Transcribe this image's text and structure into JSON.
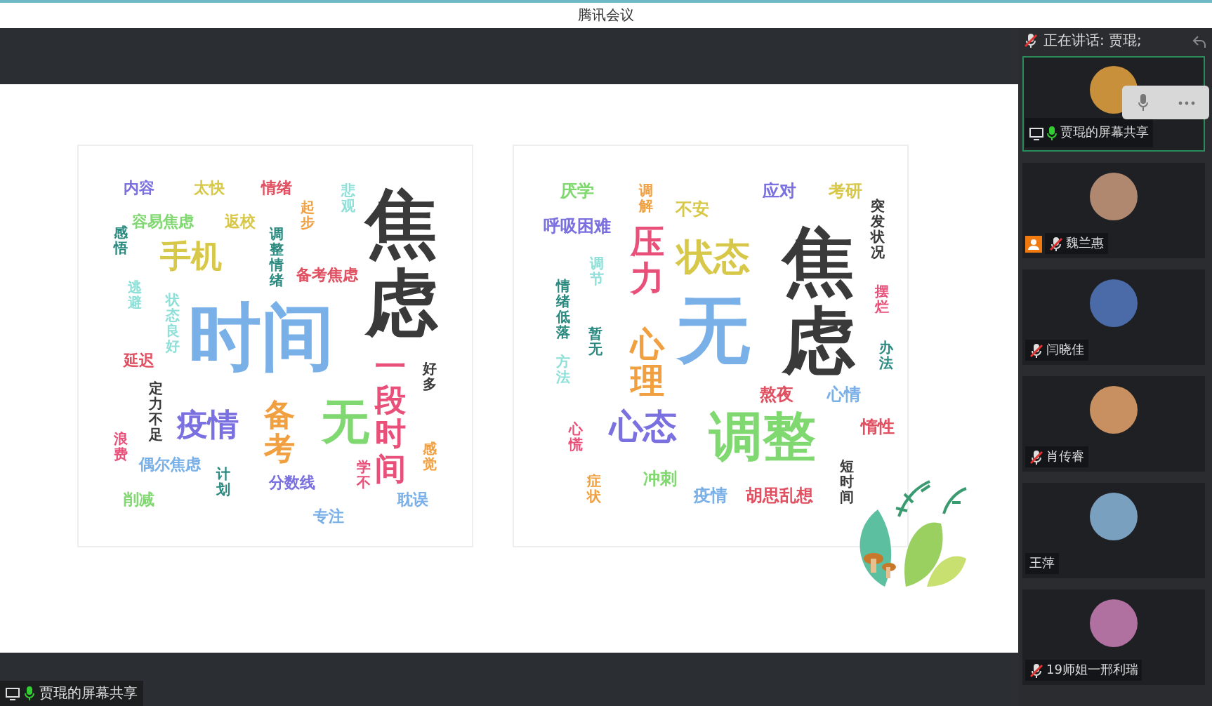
{
  "window": {
    "title": "腾讯会议"
  },
  "clouds": [
    {
      "words": [
        {
          "text": "内容",
          "color": "#7a70e0",
          "vertical": false
        },
        {
          "text": "太快",
          "color": "#d8c84a",
          "vertical": false
        },
        {
          "text": "情绪",
          "color": "#e05060",
          "vertical": false
        },
        {
          "text": "感悟",
          "color": "#2a8a80",
          "vertical": true
        },
        {
          "text": "容易焦虑",
          "color": "#80d870",
          "vertical": false
        },
        {
          "text": "返校",
          "color": "#d8c84a",
          "vertical": false
        },
        {
          "text": "起步",
          "color": "#f0a040",
          "vertical": true
        },
        {
          "text": "悲观",
          "color": "#8fe0d8",
          "vertical": true
        },
        {
          "text": "手机",
          "color": "#d8c84a",
          "vertical": false
        },
        {
          "text": "逃避",
          "color": "#8fe0d8",
          "vertical": true
        },
        {
          "text": "调整情绪",
          "color": "#2a8a80",
          "vertical": true
        },
        {
          "text": "备考焦虑",
          "color": "#e05060",
          "vertical": false
        },
        {
          "text": "延迟",
          "color": "#e05060",
          "vertical": false
        },
        {
          "text": "状态良好",
          "color": "#8fe0d8",
          "vertical": true
        },
        {
          "text": "时间",
          "color": "#7ab0e8",
          "vertical": false
        },
        {
          "text": "焦虑",
          "color": "#3a3a3a",
          "vertical": true
        },
        {
          "text": "浪费",
          "color": "#e8507a",
          "vertical": true
        },
        {
          "text": "定力不足",
          "color": "#3a3a3a",
          "vertical": true
        },
        {
          "text": "疫情",
          "color": "#7a70e0",
          "vertical": false
        },
        {
          "text": "偶尔焦虑",
          "color": "#7ab0e8",
          "vertical": false
        },
        {
          "text": "削减",
          "color": "#80d870",
          "vertical": false
        },
        {
          "text": "计划",
          "color": "#2a8a80",
          "vertical": true
        },
        {
          "text": "备考",
          "color": "#f0a040",
          "vertical": true
        },
        {
          "text": "无",
          "color": "#80d870",
          "vertical": false
        },
        {
          "text": "分数线",
          "color": "#7a70e0",
          "vertical": false
        },
        {
          "text": "学不",
          "color": "#e8507a",
          "vertical": true
        },
        {
          "text": "一段时间",
          "color": "#e8507a",
          "vertical": true
        },
        {
          "text": "好多",
          "color": "#3a3a3a",
          "vertical": true
        },
        {
          "text": "感觉",
          "color": "#f0a040",
          "vertical": true
        },
        {
          "text": "专注",
          "color": "#7ab0e8",
          "vertical": false
        },
        {
          "text": "耽误",
          "color": "#7ab0e8",
          "vertical": false
        }
      ]
    },
    {
      "words": [
        {
          "text": "厌学",
          "color": "#80d870",
          "vertical": false
        },
        {
          "text": "调解",
          "color": "#f0a040",
          "vertical": true
        },
        {
          "text": "不安",
          "color": "#d8c84a",
          "vertical": false
        },
        {
          "text": "应对",
          "color": "#7a70e0",
          "vertical": false
        },
        {
          "text": "考研",
          "color": "#d8c84a",
          "vertical": false
        },
        {
          "text": "呼吸困难",
          "color": "#7a70e0",
          "vertical": false
        },
        {
          "text": "情绪低落",
          "color": "#2a8a80",
          "vertical": true
        },
        {
          "text": "调节",
          "color": "#8fe0d8",
          "vertical": true
        },
        {
          "text": "压力",
          "color": "#e8507a",
          "vertical": true
        },
        {
          "text": "状态",
          "color": "#d8c84a",
          "vertical": false
        },
        {
          "text": "方法",
          "color": "#8fe0d8",
          "vertical": true
        },
        {
          "text": "暂无",
          "color": "#2a8a80",
          "vertical": true
        },
        {
          "text": "心理",
          "color": "#f0a040",
          "vertical": true
        },
        {
          "text": "无",
          "color": "#7ab0e8",
          "vertical": false
        },
        {
          "text": "焦虑",
          "color": "#3a3a3a",
          "vertical": true
        },
        {
          "text": "突发状况",
          "color": "#3a3a3a",
          "vertical": true
        },
        {
          "text": "摆烂",
          "color": "#e8507a",
          "vertical": true
        },
        {
          "text": "办法",
          "color": "#2a8a80",
          "vertical": true
        },
        {
          "text": "熬夜",
          "color": "#e05060",
          "vertical": false
        },
        {
          "text": "心情",
          "color": "#7ab0e8",
          "vertical": false
        },
        {
          "text": "心慌",
          "color": "#e8507a",
          "vertical": true
        },
        {
          "text": "心态",
          "color": "#7a70e0",
          "vertical": false
        },
        {
          "text": "调整",
          "color": "#80d870",
          "vertical": false
        },
        {
          "text": "惰性",
          "color": "#e05060",
          "vertical": false
        },
        {
          "text": "症状",
          "color": "#f0a040",
          "vertical": true
        },
        {
          "text": "冲刺",
          "color": "#80d870",
          "vertical": false
        },
        {
          "text": "疫情",
          "color": "#7ab0e8",
          "vertical": false
        },
        {
          "text": "胡思乱想",
          "color": "#e05060",
          "vertical": false
        },
        {
          "text": "短时间",
          "color": "#3a3a3a",
          "vertical": true
        }
      ]
    }
  ],
  "speaking": "正在讲话: 贾琨;",
  "participants": [
    {
      "name": "贾琨的屏幕共享",
      "mic_shown": true,
      "muted": false,
      "sharing": true,
      "host": false,
      "speaking": true
    },
    {
      "name": "魏兰惠",
      "mic_shown": true,
      "muted": true,
      "sharing": false,
      "host": true,
      "speaking": false
    },
    {
      "name": "闫晓佳",
      "mic_shown": true,
      "muted": true,
      "sharing": false,
      "host": false,
      "speaking": false
    },
    {
      "name": "肖传睿",
      "mic_shown": true,
      "muted": true,
      "sharing": false,
      "host": false,
      "speaking": false
    },
    {
      "name": "王萍",
      "mic_shown": false,
      "sharing": false,
      "host": false,
      "speaking": false
    },
    {
      "name": "19师姐一邢利瑞",
      "mic_shown": true,
      "muted": true,
      "sharing": false,
      "host": false,
      "speaking": false
    }
  ],
  "share_label": "贾琨的屏幕共享"
}
